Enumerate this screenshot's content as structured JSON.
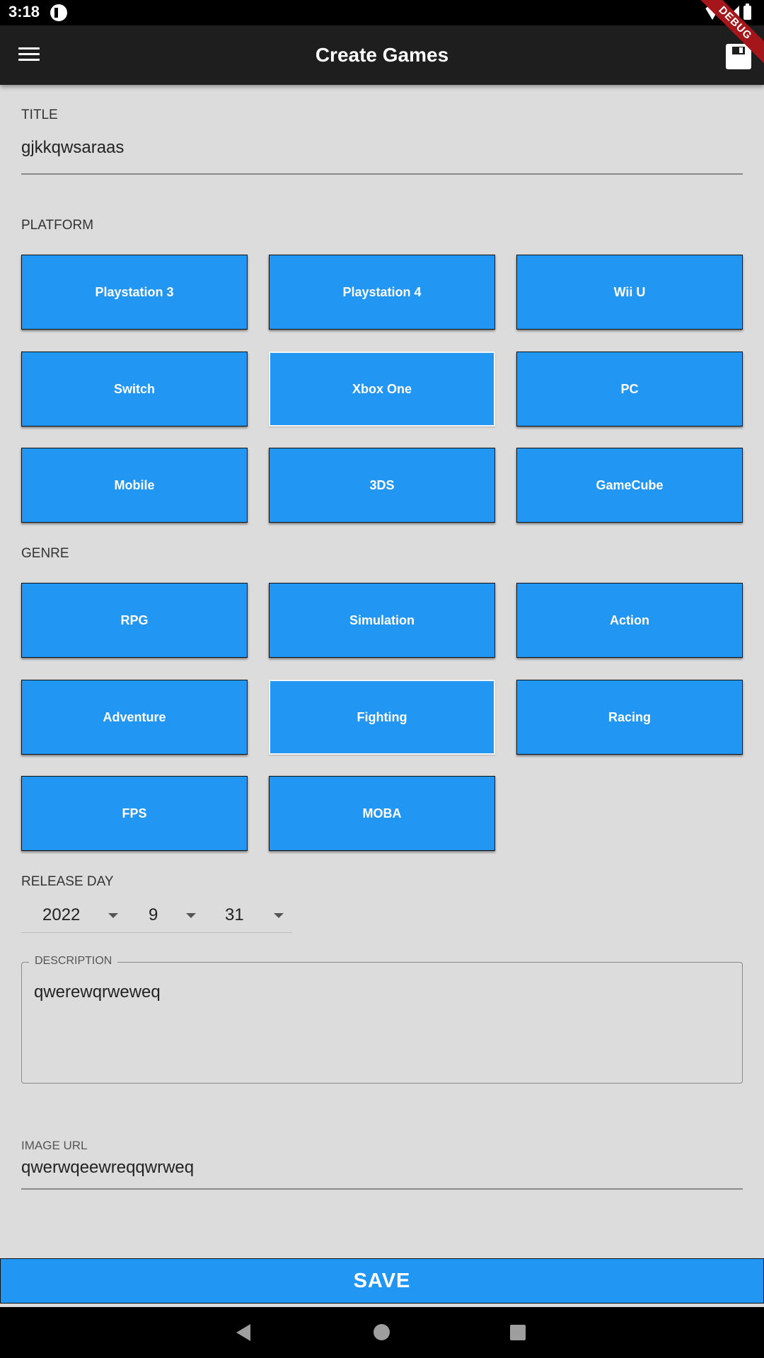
{
  "status_bar": {
    "time": "3:18",
    "debug_banner": "DEBUG"
  },
  "app_bar": {
    "title": "Create Games"
  },
  "form": {
    "title": {
      "label": "TITLE",
      "value": "gjkkqwsaraas"
    },
    "platform": {
      "label": "PLATFORM",
      "options": [
        {
          "label": "Playstation 3",
          "selected": false
        },
        {
          "label": "Playstation 4",
          "selected": false
        },
        {
          "label": "Wii U",
          "selected": false
        },
        {
          "label": "Switch",
          "selected": false
        },
        {
          "label": "Xbox One",
          "selected": true
        },
        {
          "label": "PC",
          "selected": false
        },
        {
          "label": "Mobile",
          "selected": false
        },
        {
          "label": "3DS",
          "selected": false
        },
        {
          "label": "GameCube",
          "selected": false
        }
      ]
    },
    "genre": {
      "label": "GENRE",
      "options": [
        {
          "label": "RPG",
          "selected": false
        },
        {
          "label": "Simulation",
          "selected": false
        },
        {
          "label": "Action",
          "selected": false
        },
        {
          "label": "Adventure",
          "selected": false
        },
        {
          "label": "Fighting",
          "selected": true
        },
        {
          "label": "Racing",
          "selected": false
        },
        {
          "label": "FPS",
          "selected": false
        },
        {
          "label": "MOBA",
          "selected": false
        }
      ]
    },
    "release_day": {
      "label": "RELEASE DAY",
      "year": "2022",
      "month": "9",
      "day": "31"
    },
    "description": {
      "label": "DESCRIPTION",
      "value": "qwerewqrweweq"
    },
    "image_url": {
      "label": "IMAGE URL",
      "value": "qwerwqeewreqqwrweq"
    }
  },
  "save_button": {
    "label": "SAVE"
  },
  "colors": {
    "accent": "#2196f3",
    "app_bar": "#1e1e1e",
    "background": "#dcdcdc"
  }
}
